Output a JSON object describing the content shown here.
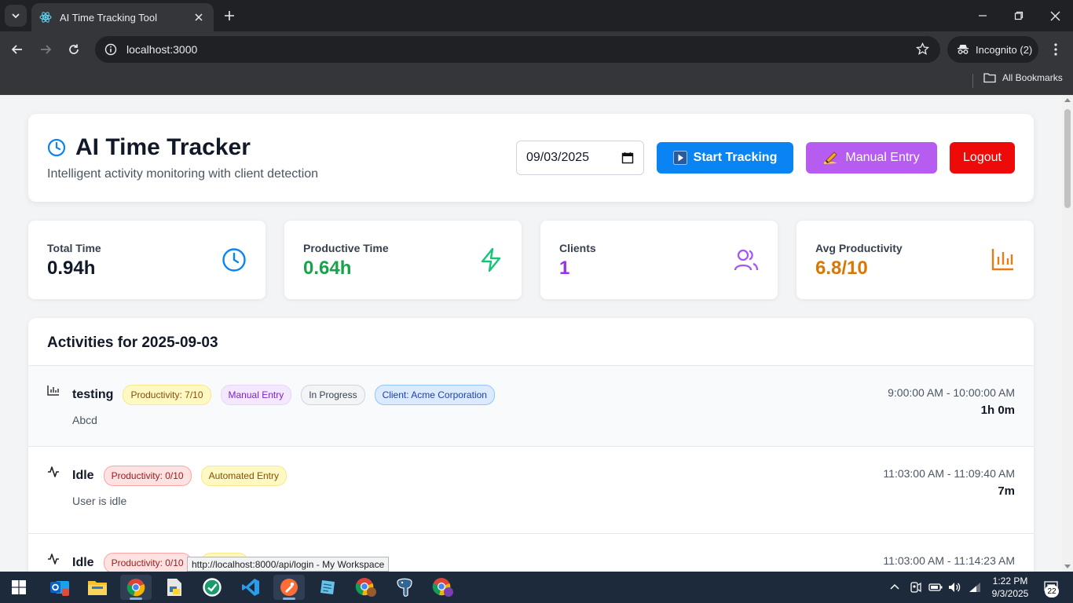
{
  "browser": {
    "tab_title": "AI Time Tracking Tool",
    "url": "localhost:3000",
    "profile_label": "Incognito (2)",
    "bookmarks_label": "All Bookmarks"
  },
  "header": {
    "title": "AI Time Tracker",
    "subtitle": "Intelligent activity monitoring with client detection",
    "date_value": "09/03/2025",
    "start_label": "Start Tracking",
    "manual_label": "Manual Entry",
    "logout_label": "Logout"
  },
  "stats": [
    {
      "label": "Total Time",
      "value": "0.94h",
      "color": "#111827",
      "icon": "clock-icon"
    },
    {
      "label": "Productive Time",
      "value": "0.64h",
      "color": "#16a34a",
      "icon": "lightning-icon"
    },
    {
      "label": "Clients",
      "value": "1",
      "color": "#9333ea",
      "icon": "users-icon"
    },
    {
      "label": "Avg Productivity",
      "value": "6.8/10",
      "color": "#d97706",
      "icon": "bar-chart-icon"
    }
  ],
  "activities": {
    "heading": "Activities for 2025-09-03",
    "items": [
      {
        "name": "testing",
        "badges": [
          "Productivity: 7/10",
          "Manual Entry",
          "In Progress",
          "Client: Acme Corporation"
        ],
        "description": "Abcd",
        "time_range": "9:00:00 AM - 10:00:00 AM",
        "duration": "1h 0m",
        "icon": "bar-chart-icon"
      },
      {
        "name": "Idle",
        "badges": [
          "Productivity: 0/10",
          "Automated Entry"
        ],
        "description": "User is idle",
        "time_range": "11:03:00 AM - 11:09:40 AM",
        "duration": "7m",
        "icon": "activity-icon"
      },
      {
        "name": "Idle",
        "badges": [
          "Productivity: 0/10"
        ],
        "description": "",
        "time_range": "11:03:00 AM - 11:14:23 AM",
        "duration": "",
        "icon": "activity-icon"
      }
    ]
  },
  "status_tooltip": "http://localhost:8000/api/login - My Workspace",
  "taskbar": {
    "time": "1:22 PM",
    "date": "9/3/2025",
    "notification_count": "22"
  }
}
